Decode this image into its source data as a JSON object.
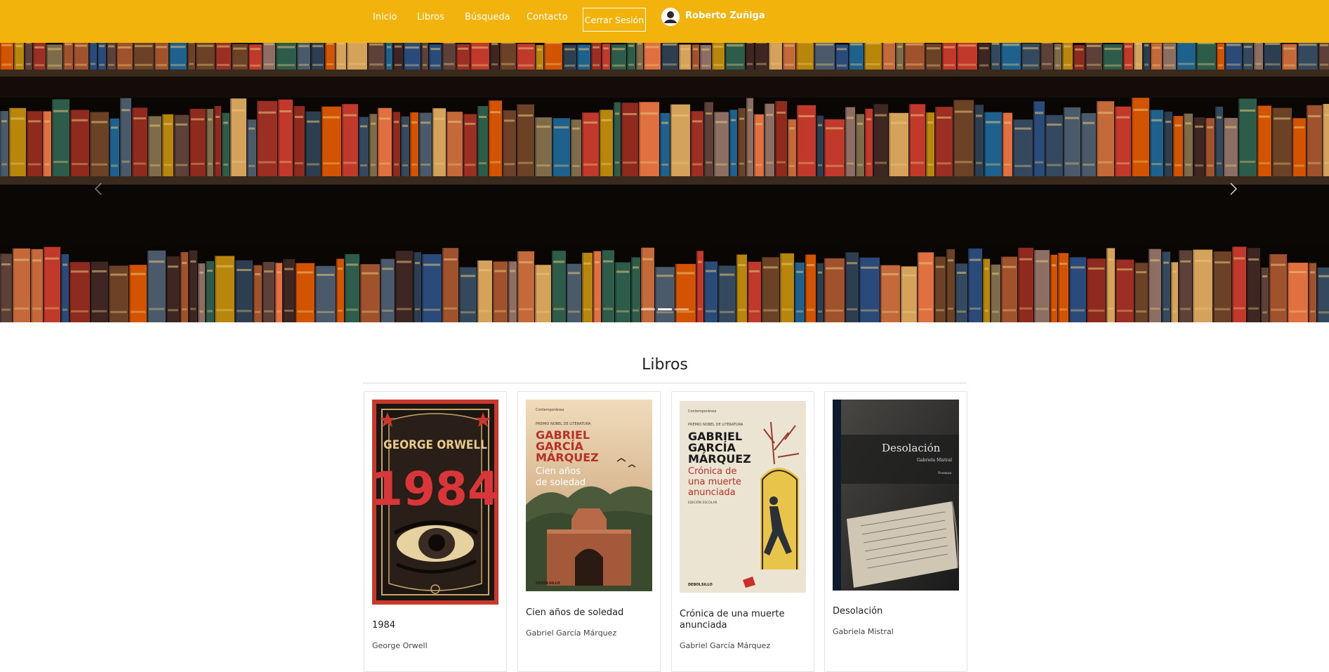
{
  "nav": {
    "links": [
      "Inicio",
      "Libros",
      "Búsqueda",
      "Contacto"
    ],
    "logout": "Cerrar Sesión",
    "user_name": "Roberto Zuñiga"
  },
  "carousel": {
    "slide_count": 3,
    "active_slide": 2
  },
  "books_section": {
    "title": "Libros",
    "books": [
      {
        "title": "1984",
        "author": "George Orwell",
        "cover_text": {
          "author": "GEORGE ORWELL",
          "title": "1984"
        }
      },
      {
        "title": "Cien años de soledad",
        "author": "Gabriel García Márquez",
        "cover_text": {
          "imprint": "Contemporánea",
          "prize": "PREMIO NOBEL DE LITERATURA",
          "author_line1": "GABRIEL",
          "author_line2": "GARCÍA",
          "author_line3": "MÁRQUEZ",
          "title_line1": "Cien años",
          "title_line2": "de soledad",
          "publisher": "DEBOLSILLO"
        }
      },
      {
        "title": "Crónica de una muerte anunciada",
        "author": "Gabriel García Márquez",
        "cover_text": {
          "imprint": "Contemporánea",
          "prize": "PREMIO NOBEL DE LITERATURA",
          "author_line1": "GABRIEL",
          "author_line2": "GARCÍA",
          "author_line3": "MÁRQUEZ",
          "title_line1": "Crónica de",
          "title_line2": "una muerte",
          "title_line3": "anunciada",
          "edition": "EDICIÓN ESCOLAR",
          "publisher": "DEBOLSILLO"
        }
      },
      {
        "title": "Desolación",
        "author": "Gabriela Mistral",
        "cover_text": {
          "title": "Desolación",
          "author": "Gabriela Mistral",
          "genre": "Poemas"
        }
      }
    ]
  },
  "colors": {
    "navbar": "#f2b30d",
    "text_dark": "#222222"
  },
  "icons": {
    "user": "user-icon",
    "prev": "chevron-left-icon",
    "next": "chevron-right-icon"
  }
}
